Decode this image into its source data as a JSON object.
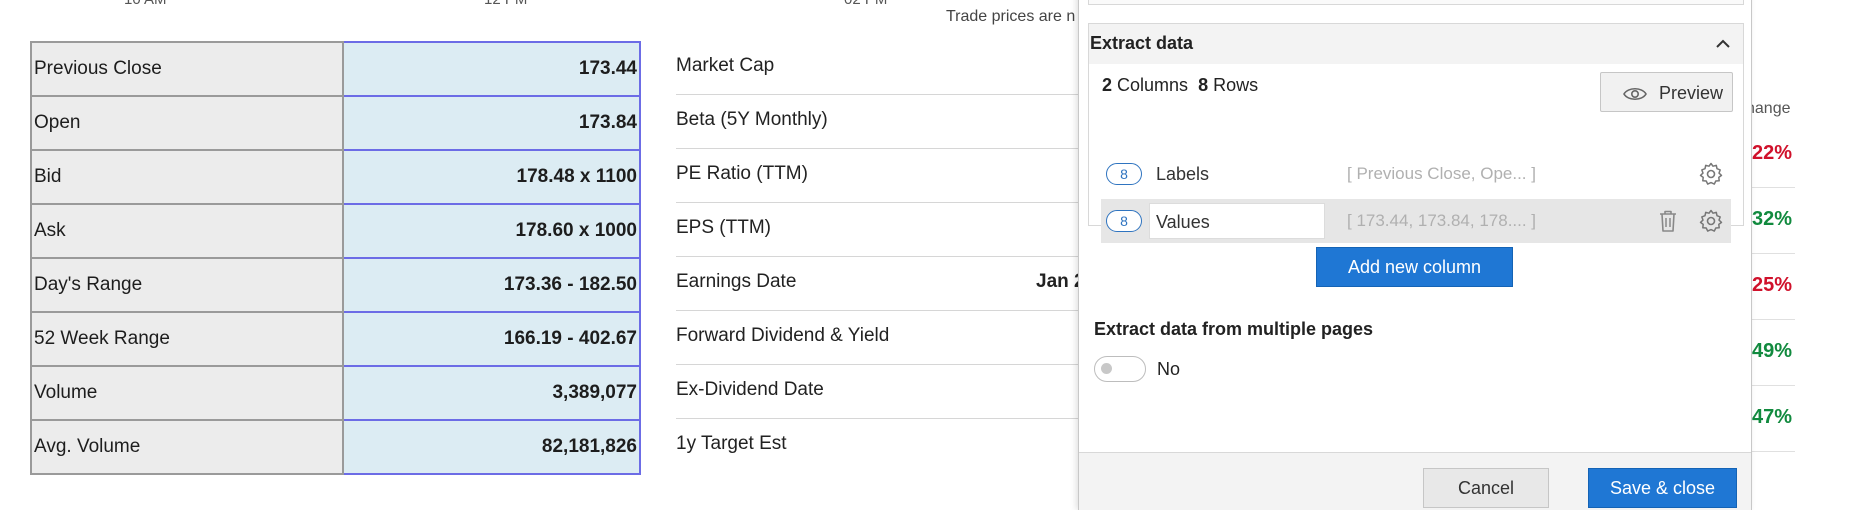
{
  "chart_axis": {
    "ticks": [
      "10 AM",
      "12 PM",
      "02 PM"
    ]
  },
  "trade_note": "Trade prices are n",
  "quote_table": {
    "rows": [
      {
        "label": "Previous Close",
        "value": "173.44"
      },
      {
        "label": "Open",
        "value": "173.84"
      },
      {
        "label": "Bid",
        "value": "178.48 x 1100"
      },
      {
        "label": "Ask",
        "value": "178.60 x 1000"
      },
      {
        "label": "Day's Range",
        "value": "173.36 - 182.50"
      },
      {
        "label": "52 Week Range",
        "value": "166.19 - 402.67"
      },
      {
        "label": "Volume",
        "value": "3,389,077"
      },
      {
        "label": "Avg. Volume",
        "value": "82,181,826"
      }
    ]
  },
  "stats_list": {
    "rows": [
      {
        "label": "Market Cap",
        "value": ""
      },
      {
        "label": "Beta (5Y Monthly)",
        "value": ""
      },
      {
        "label": "PE Ratio (TTM)",
        "value": ""
      },
      {
        "label": "EPS (TTM)",
        "value": ""
      },
      {
        "label": "Earnings Date",
        "value": "Jan 2"
      },
      {
        "label": "Forward Dividend & Yield",
        "value": ""
      },
      {
        "label": "Ex-Dividend Date",
        "value": ""
      },
      {
        "label": "1y Target Est",
        "value": ""
      }
    ]
  },
  "right_column": {
    "header": "hange",
    "values": [
      {
        "text": "22%",
        "color": "#d0112b"
      },
      {
        "text": "32%",
        "color": "#118a3e"
      },
      {
        "text": "25%",
        "color": "#d0112b"
      },
      {
        "text": "49%",
        "color": "#118a3e"
      },
      {
        "text": "47%",
        "color": "#118a3e"
      }
    ]
  },
  "panel": {
    "section_title": "Extract data",
    "columns_count": "2",
    "columns_word": "Columns",
    "rows_count": "8",
    "rows_word": "Rows",
    "preview_label": "Preview",
    "columns": [
      {
        "count": "8",
        "name": "Labels",
        "preview": "[ Previous Close, Ope... ]"
      },
      {
        "count": "8",
        "name": "Values",
        "preview": "[ 173.44, 173.84, 178.... ]"
      }
    ],
    "add_column_label": "Add new column",
    "multi_pages_title": "Extract data from multiple pages",
    "multi_pages_toggle_label": "No",
    "cancel_label": "Cancel",
    "save_label": "Save & close"
  },
  "colors": {
    "accent": "#1f77d4",
    "selected_cell_bg": "#dcecf3",
    "selected_cell_border": "#6c6ce6",
    "negative": "#d0112b",
    "positive": "#118a3e"
  }
}
